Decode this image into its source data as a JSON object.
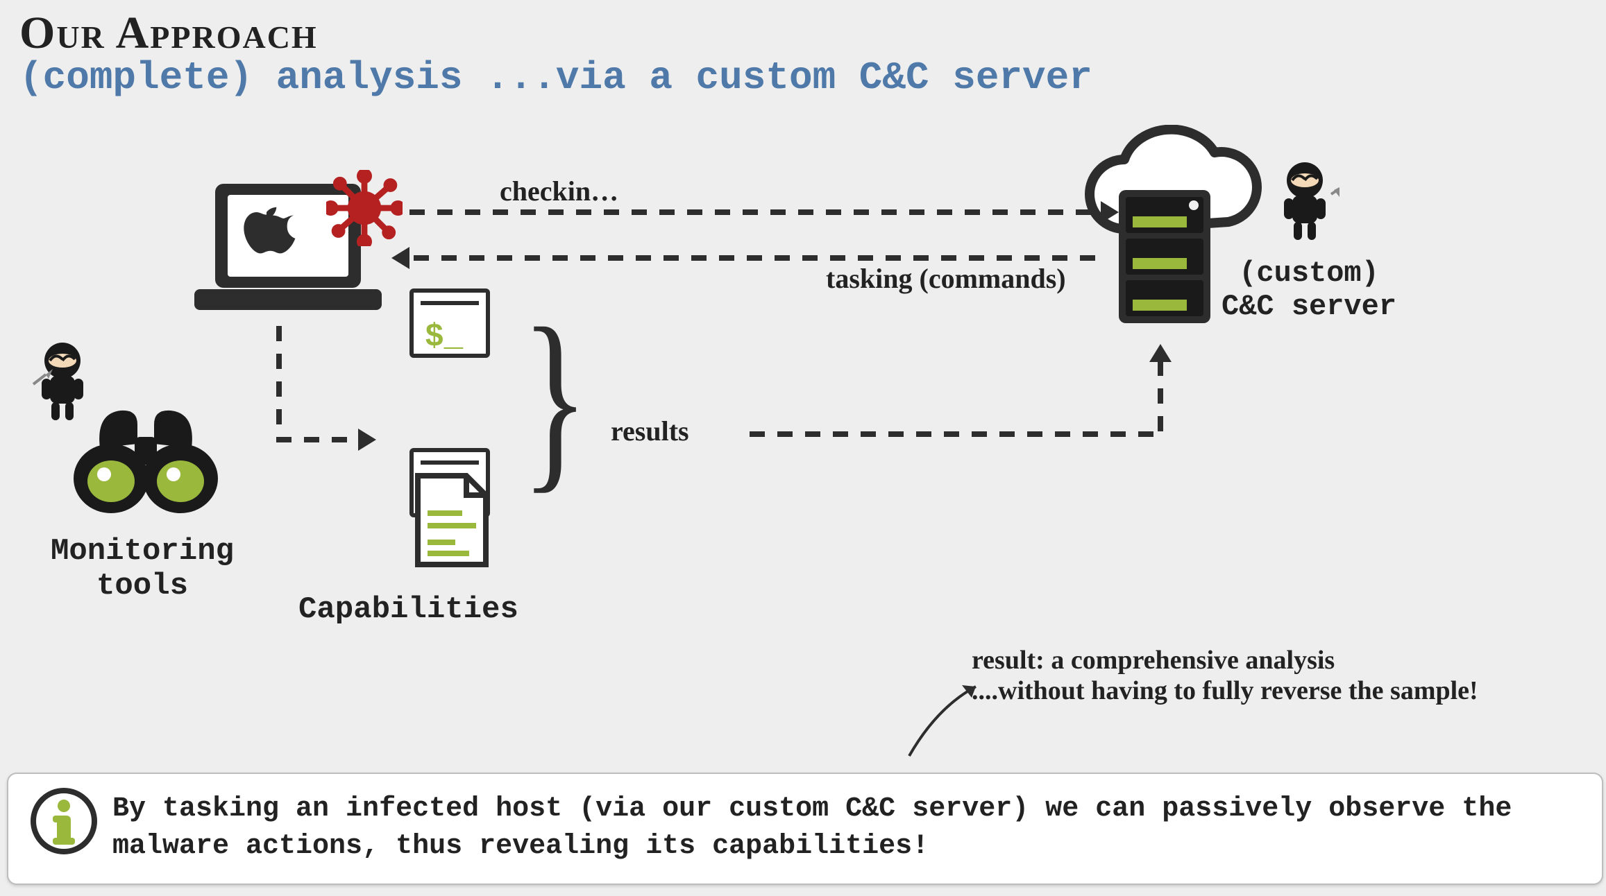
{
  "header": {
    "title": "Our Approach",
    "subtitle": "(complete) analysis ...via a custom C&C server"
  },
  "arrows": {
    "checkin": "checkin…",
    "tasking": "tasking (commands)",
    "results": "results"
  },
  "labels": {
    "monitoring_tools_line1": "Monitoring",
    "monitoring_tools_line2": "tools",
    "capabilities": "Capabilities",
    "cc_server_line1": "(custom)",
    "cc_server_line2": "C&C server"
  },
  "callout": {
    "line1": "result: a comprehensive analysis",
    "line2": "....without having to fully reverse the sample!"
  },
  "info": {
    "text": "By tasking an infected host (via our custom C&C server) we can passively observe the malware actions, thus revealing its capabilities!"
  },
  "icons": {
    "laptop": "apple-laptop-icon",
    "virus": "virus-icon",
    "binoculars": "binoculars-icon",
    "ninja": "ninja-icon",
    "terminal": "terminal-icon",
    "gear_window": "gear-window-icon",
    "document": "document-icon",
    "server": "server-rack-icon",
    "cloud": "cloud-icon",
    "info": "info-icon"
  },
  "colors": {
    "accent_green": "#99b83c",
    "accent_blue": "#4f79a8",
    "accent_red": "#b52121",
    "ink": "#2d2d2d"
  }
}
